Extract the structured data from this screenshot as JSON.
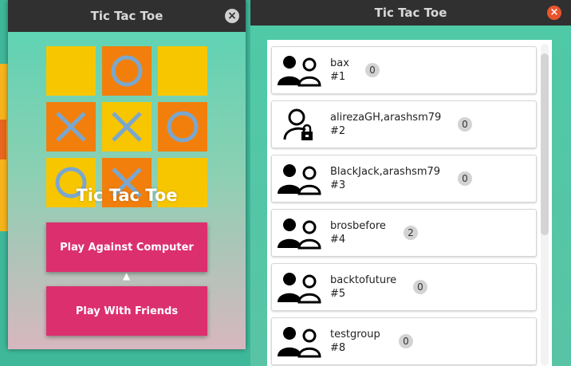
{
  "left_window": {
    "title": "Tic Tac Toe",
    "close_symbol": "×",
    "board": [
      {
        "color": "yellow",
        "mark": ""
      },
      {
        "color": "orange",
        "mark": "O"
      },
      {
        "color": "yellow",
        "mark": ""
      },
      {
        "color": "orange",
        "mark": "X"
      },
      {
        "color": "yellow",
        "mark": "X"
      },
      {
        "color": "orange",
        "mark": "O"
      },
      {
        "color": "yellow",
        "mark": "O"
      },
      {
        "color": "orange",
        "mark": "X"
      },
      {
        "color": "yellow",
        "mark": ""
      }
    ],
    "game_title": "Tic Tac Toe",
    "buttons": {
      "play_computer": "Play Against Computer",
      "play_friends": "Play With Friends"
    }
  },
  "right_window": {
    "title": "Tic Tac Toe",
    "close_symbol": "×",
    "chats": [
      {
        "name": "bax",
        "number": "#1",
        "unread": "0",
        "icon": "group-icon"
      },
      {
        "name": "alirezaGH,arashsm79",
        "number": "#2",
        "unread": "0",
        "icon": "locked-user-icon"
      },
      {
        "name": "BlackJack,arashsm79",
        "number": "#3",
        "unread": "0",
        "icon": "group-icon"
      },
      {
        "name": "brosbefore",
        "number": "#4",
        "unread": "2",
        "icon": "group-icon"
      },
      {
        "name": "backtofuture",
        "number": "#5",
        "unread": "0",
        "icon": "group-icon"
      },
      {
        "name": "testgroup",
        "number": "#8",
        "unread": "0",
        "icon": "group-icon"
      }
    ]
  },
  "colors": {
    "board_yellow": "#f7c600",
    "board_orange": "#f27f0c",
    "mark_color": "#7aa7cf",
    "button_pink": "#dc2f6e",
    "titlebar": "#303030",
    "close_red": "#e9542d"
  }
}
